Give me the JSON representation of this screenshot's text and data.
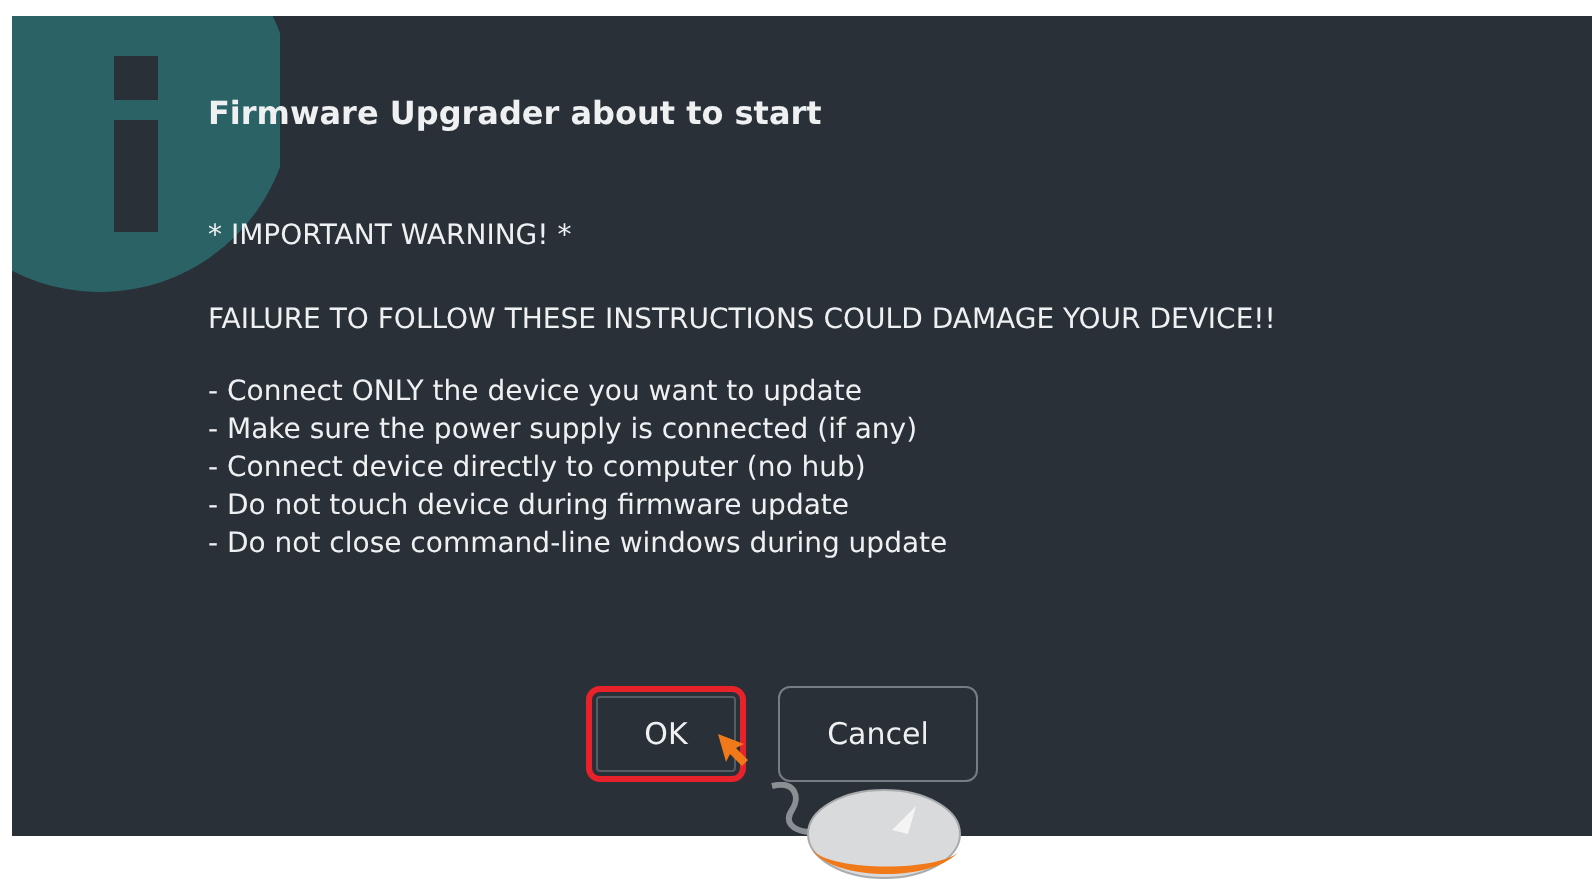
{
  "dialog": {
    "title": "Firmware Upgrader about to start",
    "warning": "* IMPORTANT WARNING! *",
    "failure": "FAILURE TO FOLLOW THESE INSTRUCTIONS COULD DAMAGE YOUR DEVICE!!",
    "instructions": [
      "- Connect ONLY the device you want to update",
      "- Make sure the power supply is connected (if any)",
      "- Connect device directly to computer (no hub)",
      "- Do not touch device during firmware update",
      "- Do not close command-line windows during update"
    ],
    "buttons": [
      {
        "label": "OK",
        "highlighted": true
      },
      {
        "label": "Cancel",
        "highlighted": false
      }
    ]
  }
}
